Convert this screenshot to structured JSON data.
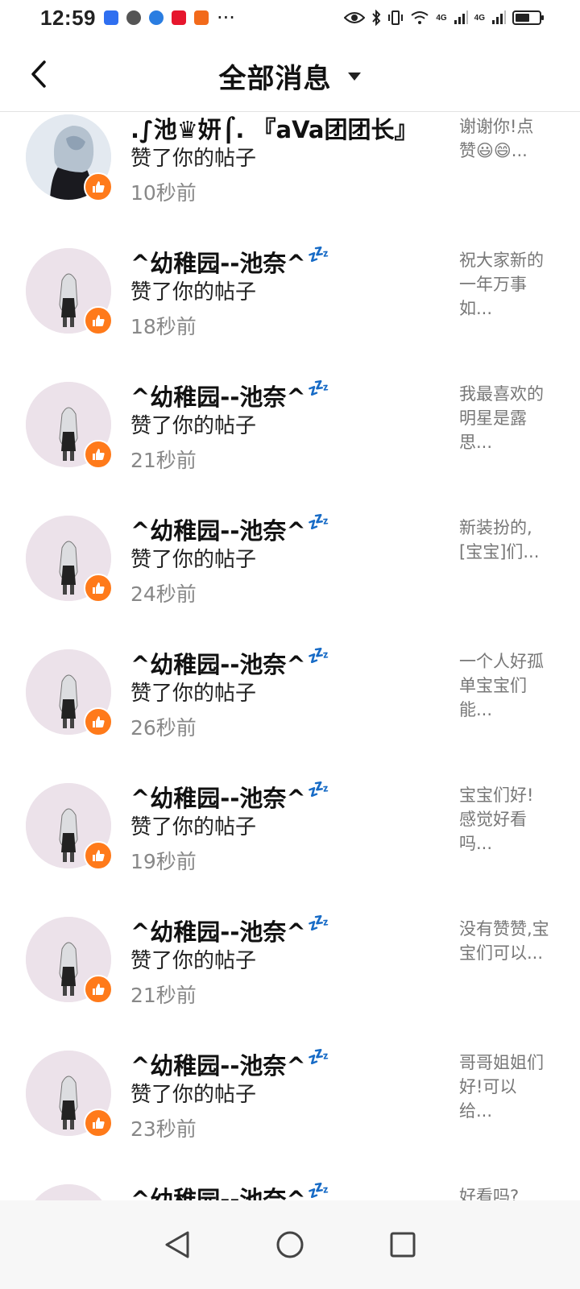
{
  "status_bar": {
    "time": "12:59",
    "more": "···",
    "network_1": "4G",
    "network_2": "4G",
    "battery_level": 0.6,
    "icons": [
      "baidu-icon",
      "wechat-icon",
      "browser-icon",
      "weibo-icon",
      "app-icon",
      "eye-icon",
      "bluetooth-icon",
      "vibrate-icon",
      "wifi-icon",
      "signal-icon",
      "battery-icon"
    ]
  },
  "header": {
    "title": "全部消息",
    "back_icon": "chevron-left-icon",
    "dropdown_icon": "caret-down-icon"
  },
  "items": [
    {
      "name": ".∫池♛妍⌠. 『aVa团团长』",
      "zzz": "",
      "action": "赞了你的帖子",
      "time": "10秒前",
      "preview": "谢谢你!点赞😃😄..."
    },
    {
      "name": "^幼稚园--池奈^",
      "zzz": "💤",
      "action": "赞了你的帖子",
      "time": "18秒前",
      "preview": "祝大家新的一年万事如..."
    },
    {
      "name": "^幼稚园--池奈^",
      "zzz": "💤",
      "action": "赞了你的帖子",
      "time": "21秒前",
      "preview": "我最喜欢的明星是露思..."
    },
    {
      "name": "^幼稚园--池奈^",
      "zzz": "💤",
      "action": "赞了你的帖子",
      "time": "24秒前",
      "preview": "新装扮的,[宝宝]们..."
    },
    {
      "name": "^幼稚园--池奈^",
      "zzz": "💤",
      "action": "赞了你的帖子",
      "time": "26秒前",
      "preview": "一个人好孤单宝宝们能..."
    },
    {
      "name": "^幼稚园--池奈^",
      "zzz": "💤",
      "action": "赞了你的帖子",
      "time": "19秒前",
      "preview": "宝宝们好!感觉好看吗..."
    },
    {
      "name": "^幼稚园--池奈^",
      "zzz": "💤",
      "action": "赞了你的帖子",
      "time": "21秒前",
      "preview": "没有赞赞,宝宝们可以..."
    },
    {
      "name": "^幼稚园--池奈^",
      "zzz": "💤",
      "action": "赞了你的帖子",
      "time": "23秒前",
      "preview": "哥哥姐姐们好!可以给..."
    },
    {
      "name": "^幼稚园--池奈^",
      "zzz": "💤",
      "action": "",
      "time": "",
      "preview": "好看吗?"
    }
  ],
  "colors": {
    "badge": "#ff7a1a",
    "zzz": "#3d8ef0",
    "muted": "#888888"
  },
  "nav": {
    "icons": [
      "back-triangle-icon",
      "home-circle-icon",
      "recents-square-icon"
    ]
  }
}
